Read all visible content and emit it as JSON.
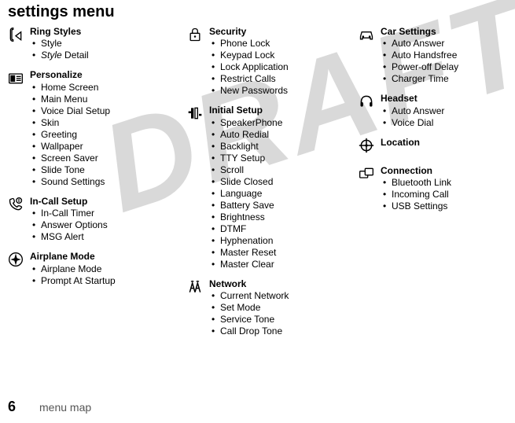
{
  "page": {
    "title": "settings menu",
    "footer_label": "menu map",
    "page_number": "6",
    "watermark": "DRAFT"
  },
  "sections": {
    "ring_styles": {
      "heading": "Ring Styles",
      "items": [
        "Style",
        "Style Detail"
      ],
      "italic_indices": [
        1
      ]
    },
    "personalize": {
      "heading": "Personalize",
      "items": [
        "Home Screen",
        "Main Menu",
        "Voice Dial Setup",
        "Skin",
        "Greeting",
        "Wallpaper",
        "Screen Saver",
        "Slide Tone",
        "Sound Settings"
      ]
    },
    "in_call": {
      "heading": "In-Call Setup",
      "items": [
        "In-Call Timer",
        "Answer Options",
        "MSG Alert"
      ]
    },
    "airplane": {
      "heading": "Airplane Mode",
      "items": [
        "Airplane Mode",
        "Prompt At Startup"
      ]
    },
    "security": {
      "heading": "Security",
      "items": [
        "Phone Lock",
        "Keypad Lock",
        "Lock Application",
        "Restrict Calls",
        "New Passwords"
      ]
    },
    "initial_setup": {
      "heading": "Initial Setup",
      "items": [
        "SpeakerPhone",
        "Auto Redial",
        "Backlight",
        "TTY Setup",
        "Scroll",
        "Slide Closed",
        "Language",
        "Battery Save",
        "Brightness",
        "DTMF",
        "Hyphenation",
        "Master Reset",
        "Master Clear"
      ]
    },
    "network": {
      "heading": "Network",
      "items": [
        "Current Network",
        "Set Mode",
        "Service Tone",
        "Call Drop Tone"
      ]
    },
    "car_settings": {
      "heading": "Car Settings",
      "items": [
        "Auto Answer",
        "Auto Handsfree",
        "Power-off Delay",
        "Charger Time"
      ]
    },
    "headset": {
      "heading": "Headset",
      "items": [
        "Auto Answer",
        "Voice Dial"
      ]
    },
    "location": {
      "heading": "Location",
      "items": []
    },
    "connection": {
      "heading": "Connection",
      "items": [
        "Bluetooth Link",
        "Incoming Call",
        "USB Settings"
      ]
    }
  }
}
